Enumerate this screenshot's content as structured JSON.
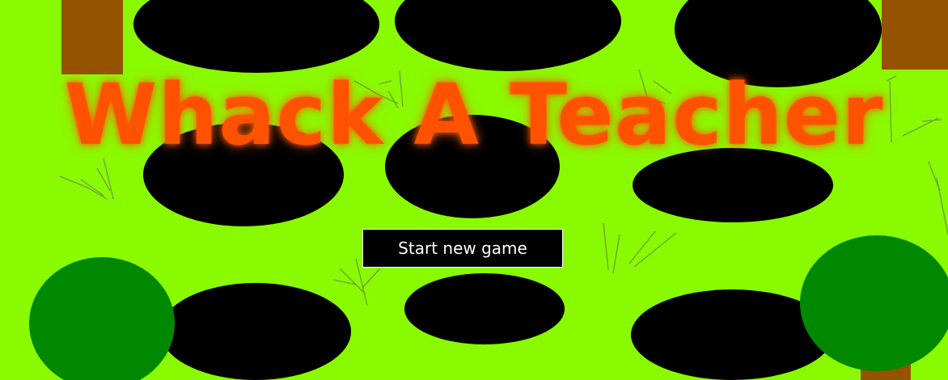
{
  "game": {
    "title": "Whack A Teacher",
    "start_button_label": "Start new game"
  },
  "colors": {
    "grass": "#8afa00",
    "hole": "#000000",
    "title": "#ff5200",
    "tree_trunk": "#955200",
    "tree_foliage": "#008800",
    "grass_strokes": "#6ca03a",
    "button_bg": "#000000",
    "button_text": "#ffffff"
  },
  "scene": {
    "hole_count": 9,
    "hole_rows": 3,
    "hole_columns": 3
  }
}
